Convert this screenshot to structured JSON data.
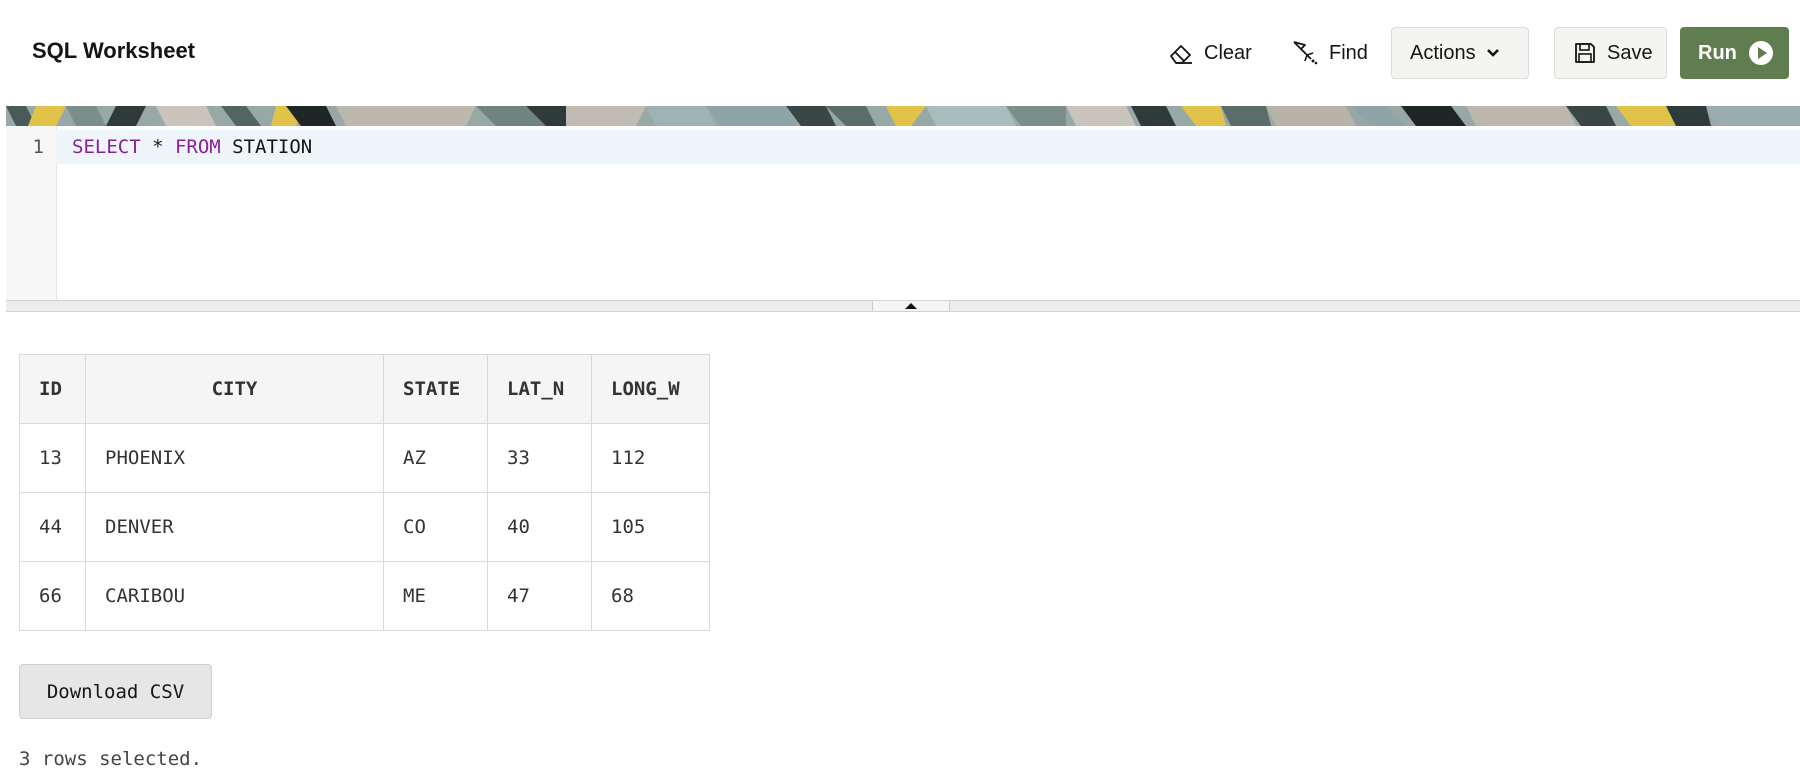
{
  "header": {
    "title": "SQL Worksheet",
    "clear_label": "Clear",
    "find_label": "Find",
    "actions_label": "Actions",
    "save_label": "Save",
    "run_label": "Run"
  },
  "editor": {
    "line_number": "1",
    "code_keyword_1": "SELECT",
    "code_middle": " * ",
    "code_keyword_2": "FROM",
    "code_rest": " STATION"
  },
  "results": {
    "columns": [
      "ID",
      "CITY",
      "STATE",
      "LAT_N",
      "LONG_W"
    ],
    "rows": [
      [
        "13",
        "PHOENIX",
        "AZ",
        "33",
        "112"
      ],
      [
        "44",
        "DENVER",
        "CO",
        "40",
        "105"
      ],
      [
        "66",
        "CARIBOU",
        "ME",
        "47",
        "68"
      ]
    ],
    "download_label": "Download CSV",
    "status_text": "3 rows selected."
  },
  "colors": {
    "run_button": "#5f7d4f",
    "keyword": "#8b1f99",
    "active_line": "#eef6fc"
  },
  "icons": [
    "eraser-icon",
    "find-icon",
    "chevron-down-icon",
    "save-icon",
    "play-circle-icon"
  ]
}
